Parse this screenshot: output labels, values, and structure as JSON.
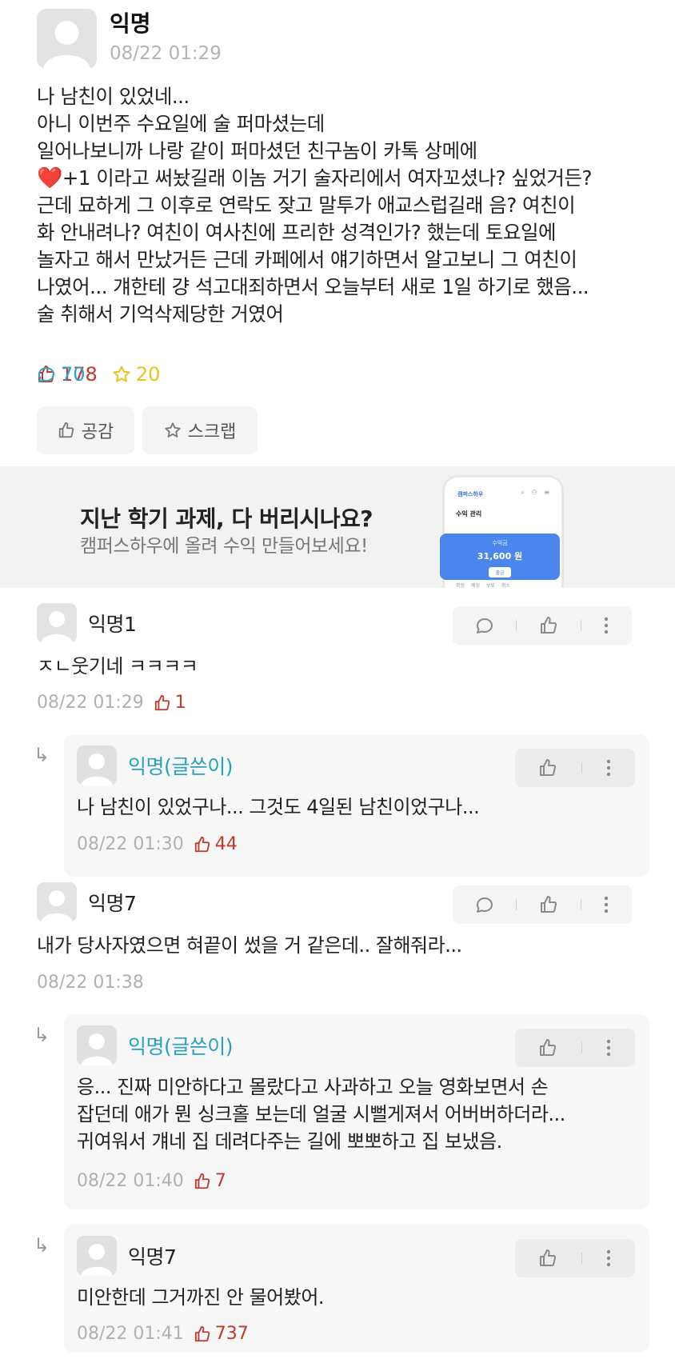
{
  "post": {
    "author": "익명",
    "time": "08/22 01:29",
    "lines": [
      "나 남친이 있었네...",
      "아니 이번주 수요일에 술 퍼마셨는데",
      "일어나보니까 나랑 같이 퍼마셨던 친구놈이 카톡 상메에",
      "+1 이라고 써놨길래 이놈 거기 술자리에서 여자꼬셨나? 싶었거든?",
      "근데 묘하게 그 이후로 연락도 잦고 말투가 애교스럽길래 음? 여친이",
      "화 안내려나? 여친이 여사친에 프리한 성격인가? 했는데 토요일에",
      "놀자고 해서 만났거든 근데 카페에서 얘기하면서 알고보니 그 여친이",
      "나였어... 걔한테 걍 석고대죄하면서 오늘부터 새로 1일 하기로 했음...",
      "술 취해서 기억삭제당한 거였어"
    ],
    "heart_emoji": "❤️",
    "likes": "178",
    "comments": "70",
    "scraps": "20",
    "empathy_label": "공감",
    "scrap_label": "스크랩",
    "colors": {
      "like": "#c0392b",
      "comment": "#2aa5c5",
      "scrap": "#e9c41c",
      "op": "#27a1bd"
    }
  },
  "ad": {
    "title": "지난 학기 과제, 다 버리시나요?",
    "subtitle": "캠퍼스하우에 올려 수익 만들어보세요!",
    "phone_brand": "캠퍼스하우",
    "phone_section": "수익 관리",
    "phone_card_label": "수익금",
    "phone_amount": "31,600 원",
    "phone_button": "출금",
    "phone_tabs": "확정 예정 보류 취소"
  },
  "comments": [
    {
      "author": "익명1",
      "text": "ㅈㄴ웃기네 ㅋㅋㅋㅋ",
      "time": "08/22 01:29",
      "likes": "1"
    },
    {
      "author": "익명(글쓴이)",
      "text": "나 남친이 있었구나... 그것도 4일된 남친이었구나...",
      "time": "08/22 01:30",
      "likes": "44"
    },
    {
      "author": "익명7",
      "text": "내가 당사자였으면 혀끝이 썼을 거 같은데.. 잘해줘라...",
      "time": "08/22 01:38",
      "likes": ""
    },
    {
      "author": "익명(글쓴이)",
      "lines": [
        "응... 진짜 미안하다고 몰랐다고 사과하고 오늘 영화보면서 손",
        "잡던데 애가 뭔 싱크홀 보는데 얼굴 시뻘게져서 어버버하더라...",
        "귀여워서 걔네 집 데려다주는 길에 뽀뽀하고 집 보냈음."
      ],
      "time": "08/22 01:40",
      "likes": "7"
    },
    {
      "author": "익명7",
      "text": "미안한데 그거까진 안 물어봤어.",
      "time": "08/22 01:41",
      "likes": "737"
    }
  ],
  "reply_arrow": "↳"
}
